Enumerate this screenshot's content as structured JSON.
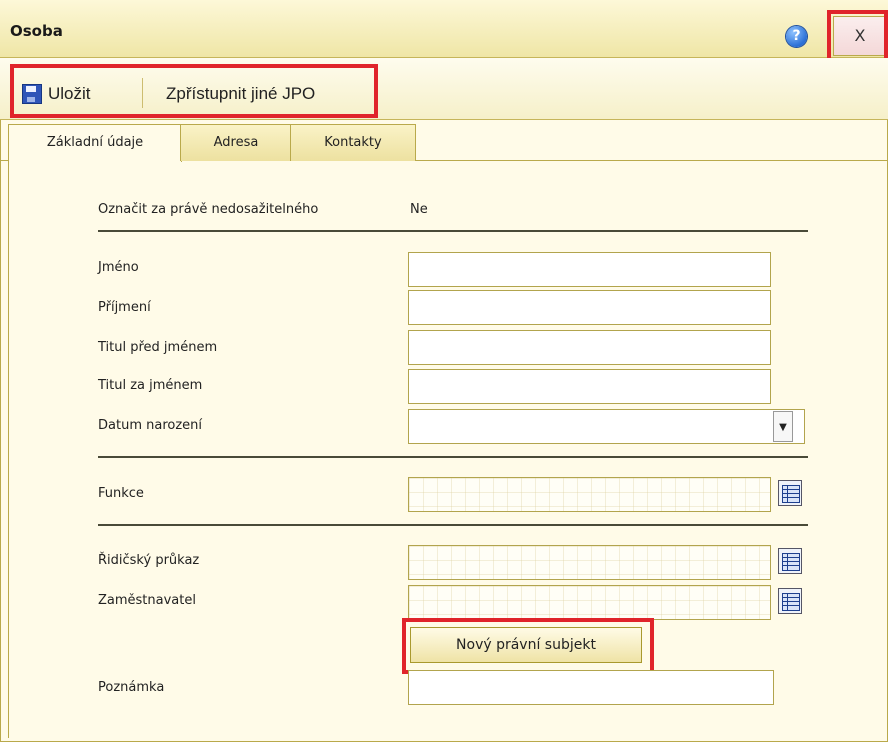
{
  "window": {
    "title": "Osoba",
    "help_glyph": "?",
    "close_label": "X"
  },
  "toolbar": {
    "save_label": "Uložit",
    "access_label": "Zpřístupnit jiné JPO"
  },
  "tabs": [
    {
      "label": "Základní údaje",
      "active": true
    },
    {
      "label": "Adresa",
      "active": false
    },
    {
      "label": "Kontakty",
      "active": false
    }
  ],
  "form": {
    "unreachable": {
      "label": "Označit za právě nedosažitelného",
      "value": "Ne"
    },
    "first_name": {
      "label": "Jméno",
      "value": ""
    },
    "last_name": {
      "label": "Příjmení",
      "value": ""
    },
    "title_before": {
      "label": "Titul před jménem",
      "value": ""
    },
    "title_after": {
      "label": "Titul za jménem",
      "value": ""
    },
    "birth_date": {
      "label": "Datum narození",
      "value": ""
    },
    "function": {
      "label": "Funkce",
      "value": ""
    },
    "driving_license": {
      "label": "Řidičský průkaz",
      "value": ""
    },
    "employer": {
      "label": "Zaměstnavatel",
      "value": ""
    },
    "new_subject_label": "Nový právní subjekt",
    "note": {
      "label": "Poznámka",
      "value": ""
    }
  },
  "colors": {
    "highlight": "#e0242b",
    "frame": "#b9a94b",
    "panel_bg": "#fffbe8"
  },
  "icons": {
    "help": "help-icon",
    "save": "floppy-disk-icon",
    "lookup": "grid-list-icon",
    "dropdown": "chevron-down-icon"
  }
}
